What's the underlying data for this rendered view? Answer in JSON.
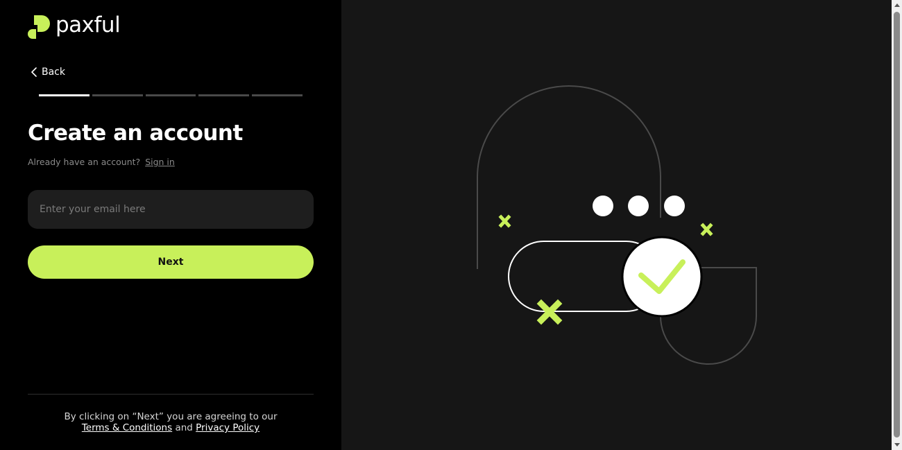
{
  "brand": {
    "name": "paxful",
    "accent": "#c8f05a"
  },
  "nav": {
    "back_label": "Back"
  },
  "progress": {
    "steps_total": 5,
    "current_step": 1
  },
  "form": {
    "title": "Create an account",
    "signin_prompt": "Already have an account?",
    "signin_link": "Sign in",
    "email_placeholder": "Enter your email here",
    "next_label": "Next"
  },
  "legal": {
    "prefix": "By clicking on “Next” you are agreeing to our",
    "terms_link": "Terms & Conditions",
    "conjunction": "and",
    "privacy_link": "Privacy Policy"
  },
  "illustration": {
    "semantic": "account-verified-illustration"
  },
  "icons": {
    "back": "chevron-left-icon",
    "logo": "paxful-logo-icon"
  }
}
